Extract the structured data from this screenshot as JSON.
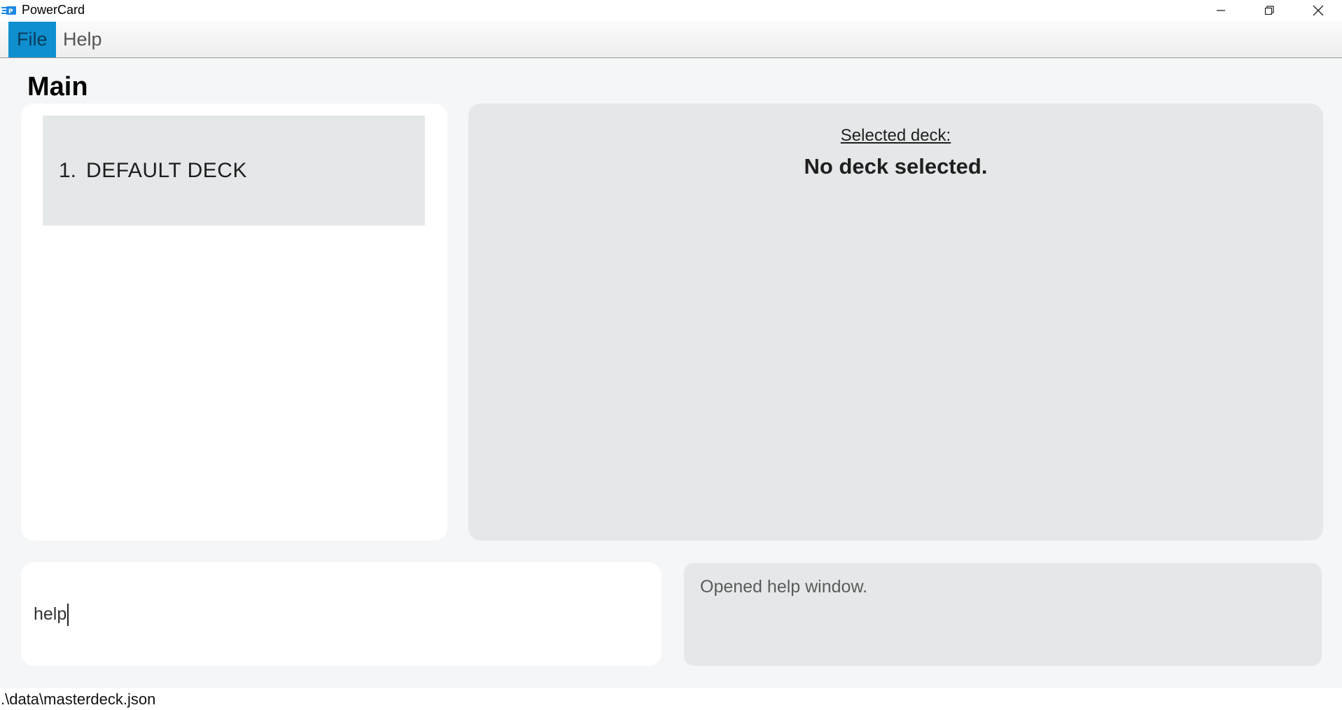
{
  "window": {
    "title": "PowerCard",
    "icon": "powercard-app-icon",
    "controls": [
      "minimize-icon",
      "restore-icon",
      "close-icon"
    ]
  },
  "menu": {
    "items": [
      {
        "label": "File",
        "active": true
      },
      {
        "label": "Help",
        "active": false
      }
    ]
  },
  "main": {
    "title": "Main"
  },
  "deck_list": {
    "items": [
      {
        "index": "1.",
        "name": "DEFAULT DECK"
      }
    ]
  },
  "detail": {
    "label": "Selected deck:",
    "value": "No deck selected."
  },
  "command": {
    "value": "help"
  },
  "result": {
    "text": "Opened help window."
  },
  "status": {
    "path": ".\\data\\masterdeck.json"
  },
  "colors": {
    "accent": "#0f8fcf",
    "panel": "#e4e8e9",
    "background": "#f4f6f7"
  }
}
